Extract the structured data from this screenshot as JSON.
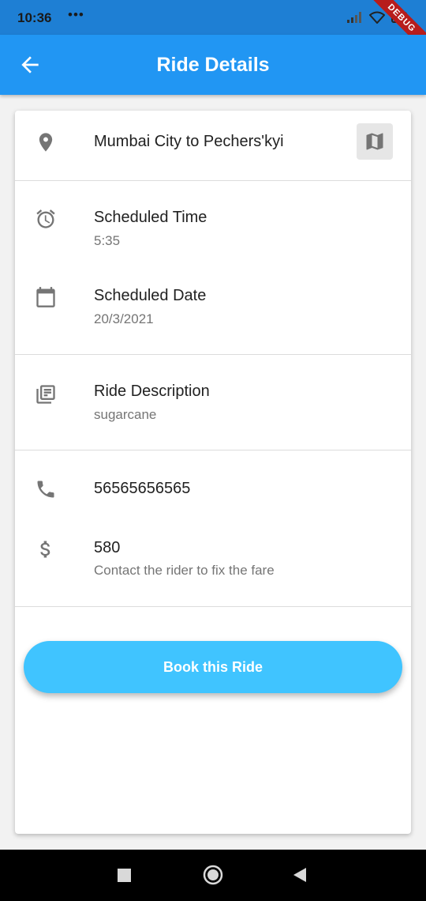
{
  "status_bar": {
    "time": "10:36",
    "dots": "•••",
    "debug_label": "DEBUG"
  },
  "app_bar": {
    "title": "Ride Details",
    "back_icon": "arrow-back-icon"
  },
  "route": {
    "text": "Mumbai City to Pechers'kyi",
    "icon": "location-pin-icon",
    "map_icon": "map-icon"
  },
  "schedule": {
    "time_label": "Scheduled Time",
    "time_value": "5:35",
    "date_label": "Scheduled Date",
    "date_value": "20/3/2021"
  },
  "description": {
    "label": "Ride Description",
    "value": "sugarcane"
  },
  "contact": {
    "phone": "56565656565",
    "fare": "580",
    "fare_note": "Contact the rider to fix the fare"
  },
  "actions": {
    "book_label": "Book this Ride"
  },
  "colors": {
    "app_bar": "#2196f3",
    "button": "#40c4ff",
    "icon": "#757575"
  }
}
